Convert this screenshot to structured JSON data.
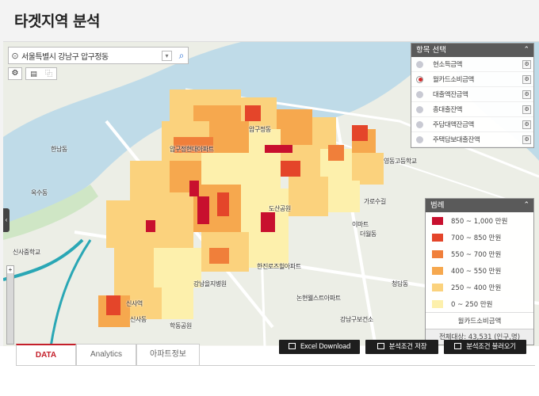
{
  "page": {
    "title": "타겟지역 분석"
  },
  "search": {
    "value": "서울특별시 강남구 압구정동"
  },
  "map_tools": {
    "tool1": "⚙",
    "tool2a": "▤",
    "tool2b": "⿻",
    "side_tab": "‹",
    "zoom_plus": "+"
  },
  "items_panel": {
    "title": "항목 선택",
    "collapse": "⌃",
    "items": [
      {
        "label": "현소득금액",
        "selected": false
      },
      {
        "label": "월카드소비금액",
        "selected": true
      },
      {
        "label": "대출액잔금액",
        "selected": false
      },
      {
        "label": "총대출잔액",
        "selected": false
      },
      {
        "label": "주담대액잔금액",
        "selected": false
      },
      {
        "label": "주택담보대출잔액",
        "selected": false
      }
    ]
  },
  "legend": {
    "title": "범례",
    "collapse": "⌃",
    "rows": [
      {
        "label": "850 ~ 1,000 만원",
        "color": "#c8102e"
      },
      {
        "label": "700 ~ 850 만원",
        "color": "#e4452a"
      },
      {
        "label": "550 ~ 700 만원",
        "color": "#f07f3a"
      },
      {
        "label": "400 ~ 550 만원",
        "color": "#f6a84e"
      },
      {
        "label": "250 ~ 400 만원",
        "color": "#fbd27d"
      },
      {
        "label": "0 ~ 250 만원",
        "color": "#fdf0ac"
      }
    ],
    "footer": "월카드소비금액",
    "total": "전체대상: 43,531 (인구,명)"
  },
  "map_labels": {
    "l1": "압구정현대아파트",
    "l2": "압구정동",
    "l3": "신사동",
    "l4": "강남을지병원",
    "l5": "도산공원",
    "l6": "학동공원",
    "l7": "한진로즈힐아파트",
    "l8": "논현웰스트아파트",
    "l9": "청담동",
    "l10": "강남구보건소",
    "l11": "이마트",
    "l12": "가로수길",
    "l13": "신사역",
    "l14": "한남동",
    "l15": "옥수동",
    "l16": "영동고등학교",
    "l17": "신사중학교",
    "l18": "더월동"
  },
  "tabs": [
    {
      "label": "DATA",
      "active": true
    },
    {
      "label": "Analytics",
      "active": false
    },
    {
      "label": "아파트정보",
      "active": false
    }
  ],
  "buttons": {
    "excel": "Excel Download",
    "save": "분석조건 저장",
    "load": "분석조건 불러오기"
  }
}
